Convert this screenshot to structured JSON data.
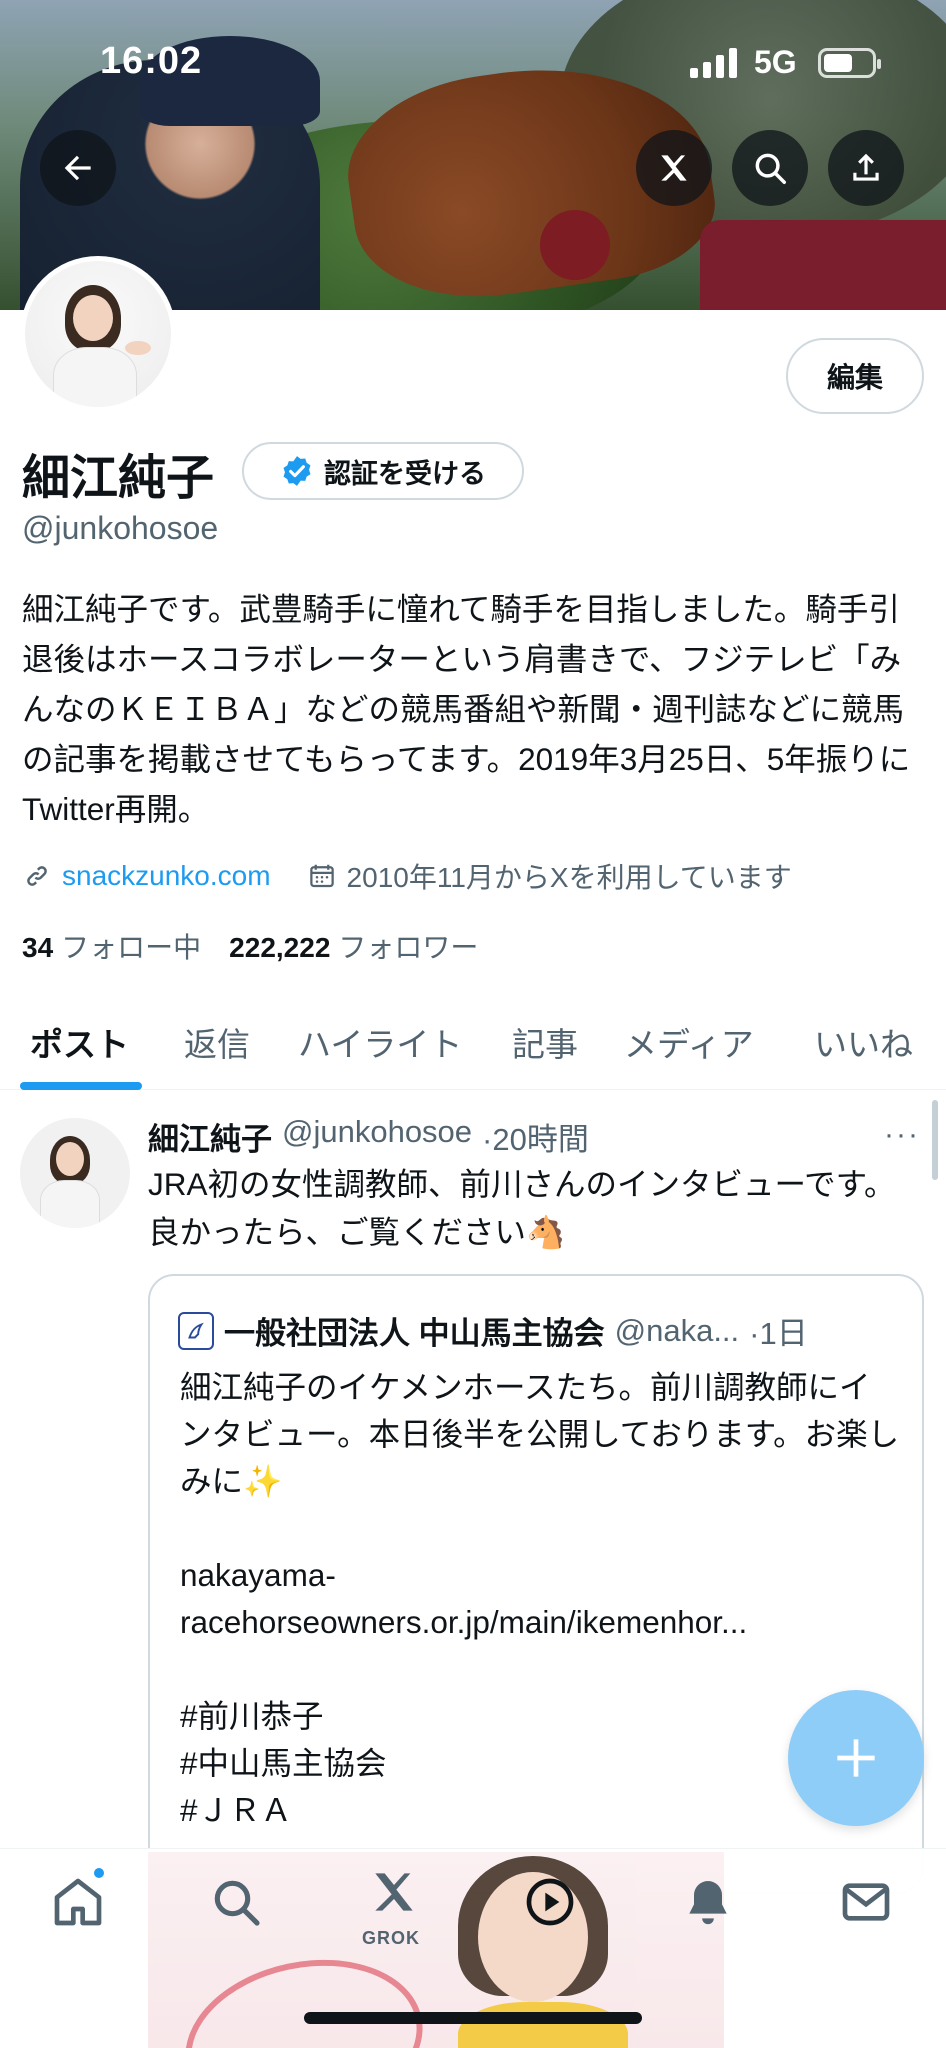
{
  "status_bar": {
    "time": "16:02",
    "network": "5G",
    "battery_level": 0.6
  },
  "header": {
    "back_icon": "arrow-left-icon",
    "grok_icon": "grok-icon",
    "search_icon": "search-icon",
    "share_icon": "share-icon"
  },
  "profile": {
    "name": "細江純子",
    "verify_label": "認証を受ける",
    "handle": "@junkohosoe",
    "edit_label": "編集",
    "bio": "細江純子です。武豊騎手に憧れて騎手を目指しました。騎手引退後はホースコラボレーターという肩書きで、フジテレビ「みんなのＫＥＩＢＡ」などの競馬番組や新聞・週刊誌などに競馬の記事を掲載させてもらってます。2019年3月25日、5年振りにTwitter再開。",
    "website": "snackzunko.com",
    "joined": "2010年11月からXを利用しています",
    "following_count": "34",
    "following_label": "フォロー中",
    "followers_count": "222,222",
    "followers_label": "フォロワー"
  },
  "tabs": [
    {
      "label": "ポスト",
      "active": true
    },
    {
      "label": "返信",
      "active": false
    },
    {
      "label": "ハイライト",
      "active": false
    },
    {
      "label": "記事",
      "active": false
    },
    {
      "label": "メディア",
      "active": false
    },
    {
      "label": "いいね",
      "active": false
    }
  ],
  "post": {
    "author": "細江純子",
    "handle": "@junkohosoe",
    "time": "·20時間",
    "more": "···",
    "text": "JRA初の女性調教師、前川さんのインタビューです。良かったら、ご覧ください🐴",
    "quote": {
      "author": "一般社団法人 中山馬主協会",
      "handle": "@naka...",
      "time": "·1日",
      "text": "細江純子のイケメンホースたち。前川調教師にインタビュー。本日後半を公開しております。お楽しみに✨\n\nnakayama-racehorseowners.or.jp/main/ikemenhor...\n\n#前川恭子\n#中山馬主協会\n#ＪＲＡ"
    }
  },
  "fab": {
    "icon": "plus-icon"
  },
  "bottom_nav": {
    "items": [
      "home-icon",
      "search-icon",
      "grok-icon",
      "notifications-icon",
      "messages-icon"
    ],
    "grok_label": "GROK",
    "accent": "#1d9bf0"
  }
}
